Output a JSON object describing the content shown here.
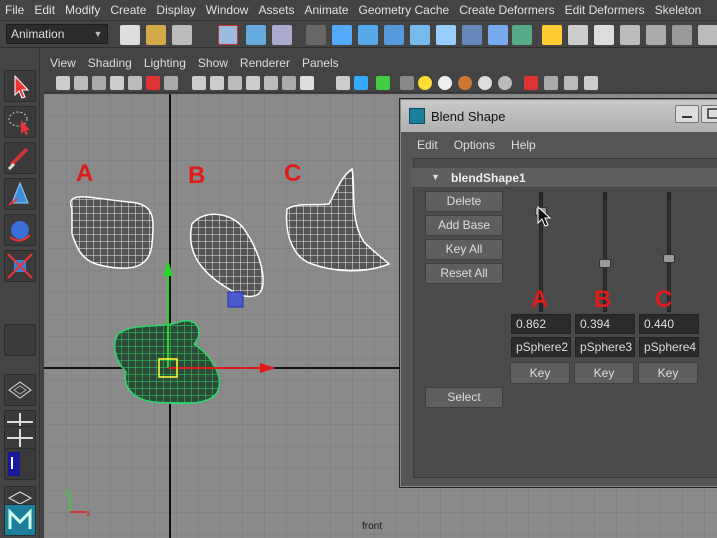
{
  "menubar": [
    "File",
    "Edit",
    "Modify",
    "Create",
    "Display",
    "Window",
    "Assets",
    "Animate",
    "Geometry Cache",
    "Create Deformers",
    "Edit Deformers",
    "Skeleton"
  ],
  "shelf": {
    "mode": "Animation"
  },
  "panel_menu": [
    "View",
    "Shading",
    "Lighting",
    "Show",
    "Renderer",
    "Panels"
  ],
  "viewport": {
    "camera_label": "front",
    "shape_labels": [
      "A",
      "B",
      "C"
    ]
  },
  "blend_window": {
    "title": "Blend Shape",
    "menu": [
      "Edit",
      "Options",
      "Help"
    ],
    "node_name": "blendShape1",
    "buttons": {
      "delete": "Delete",
      "add_base": "Add Base",
      "key_all": "Key All",
      "reset_all": "Reset All",
      "select": "Select"
    },
    "targets": [
      {
        "letter": "A",
        "value": "0.862",
        "name": "pSphere2",
        "key": "Key",
        "weight": 0.862
      },
      {
        "letter": "B",
        "value": "0.394",
        "name": "pSphere3",
        "key": "Key",
        "weight": 0.394
      },
      {
        "letter": "C",
        "value": "0.440",
        "name": "pSphere4",
        "key": "Key",
        "weight": 0.44
      }
    ]
  },
  "colors": {
    "accent_red": "#e01b1b",
    "wire_green": "#2bd66a"
  }
}
